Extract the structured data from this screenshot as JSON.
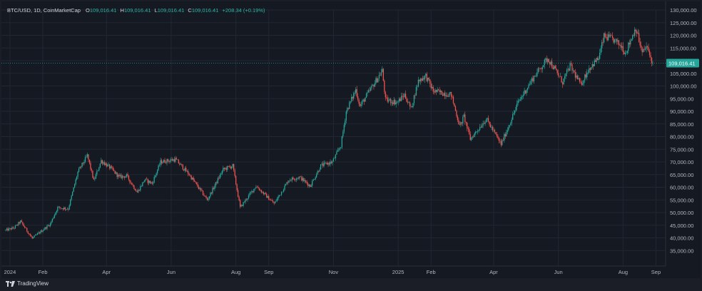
{
  "legend": {
    "symbol": "BTC/USD, 1D, CoinMarketCap",
    "open_label": "O",
    "open": "109,016.41",
    "high_label": "H",
    "high": "109,016.41",
    "low_label": "L",
    "low": "109,016.41",
    "close_label": "C",
    "close": "109,016.41",
    "change": "+208.34 (+0.19%)"
  },
  "price_badge": "109,016.41",
  "footer": {
    "brand": "TradingView",
    "logo_icon": "tradingview-logo-icon"
  },
  "colors": {
    "up": "#26a69a",
    "down": "#ef5350",
    "background": "#151922",
    "grid": "#232733",
    "text": "#b2b5be",
    "badge": "#26a69a"
  },
  "chart_data": {
    "type": "candlestick",
    "title": "BTC/USD, 1D, CoinMarketCap",
    "ylim": [
      30000,
      130000
    ],
    "y_ticks": [
      "35,000.00",
      "40,000.00",
      "45,000.00",
      "50,000.00",
      "55,000.00",
      "60,000.00",
      "65,000.00",
      "70,000.00",
      "75,000.00",
      "80,000.00",
      "85,000.00",
      "90,000.00",
      "95,000.00",
      "100,000.00",
      "105,000.00",
      "110,000.00",
      "115,000.00",
      "120,000.00",
      "125,000.00",
      "130,000.00"
    ],
    "x_ticks": [
      {
        "label": "2024",
        "date": "2024-01-01"
      },
      {
        "label": "Feb",
        "date": "2024-02-01"
      },
      {
        "label": "Apr",
        "date": "2024-04-01"
      },
      {
        "label": "Jun",
        "date": "2024-06-01"
      },
      {
        "label": "Aug",
        "date": "2024-08-01"
      },
      {
        "label": "Sep",
        "date": "2024-09-01"
      },
      {
        "label": "Nov",
        "date": "2024-11-01"
      },
      {
        "label": "2025",
        "date": "2025-01-01"
      },
      {
        "label": "Feb",
        "date": "2025-02-01"
      },
      {
        "label": "Apr",
        "date": "2025-04-01"
      },
      {
        "label": "Jun",
        "date": "2025-06-01"
      },
      {
        "label": "Aug",
        "date": "2025-08-01"
      },
      {
        "label": "Sep",
        "date": "2025-09-01"
      }
    ],
    "start_date": "2023-12-28",
    "end_date": "2025-08-29",
    "last_price": 109016.41,
    "close_path": [
      [
        "2023-12-28",
        43000
      ],
      [
        "2024-01-05",
        44000
      ],
      [
        "2024-01-11",
        46500
      ],
      [
        "2024-01-22",
        39800
      ],
      [
        "2024-02-08",
        45500
      ],
      [
        "2024-02-15",
        52000
      ],
      [
        "2024-02-25",
        51500
      ],
      [
        "2024-03-05",
        66000
      ],
      [
        "2024-03-14",
        72500
      ],
      [
        "2024-03-20",
        62500
      ],
      [
        "2024-03-27",
        70500
      ],
      [
        "2024-04-05",
        67500
      ],
      [
        "2024-04-13",
        64000
      ],
      [
        "2024-04-20",
        64500
      ],
      [
        "2024-04-30",
        58000
      ],
      [
        "2024-05-07",
        63000
      ],
      [
        "2024-05-14",
        61500
      ],
      [
        "2024-05-22",
        70000
      ],
      [
        "2024-06-05",
        71000
      ],
      [
        "2024-06-18",
        65000
      ],
      [
        "2024-07-05",
        55000
      ],
      [
        "2024-07-20",
        67000
      ],
      [
        "2024-07-29",
        68500
      ],
      [
        "2024-08-05",
        52000
      ],
      [
        "2024-08-20",
        60500
      ],
      [
        "2024-09-06",
        53500
      ],
      [
        "2024-09-20",
        63000
      ],
      [
        "2024-09-30",
        64000
      ],
      [
        "2024-10-10",
        60500
      ],
      [
        "2024-10-20",
        68500
      ],
      [
        "2024-10-31",
        70000
      ],
      [
        "2024-11-08",
        76500
      ],
      [
        "2024-11-13",
        90000
      ],
      [
        "2024-11-22",
        98500
      ],
      [
        "2024-11-26",
        92000
      ],
      [
        "2024-12-05",
        98000
      ],
      [
        "2024-12-17",
        106000
      ],
      [
        "2024-12-20",
        94500
      ],
      [
        "2024-12-31",
        93500
      ],
      [
        "2025-01-07",
        96500
      ],
      [
        "2025-01-13",
        91000
      ],
      [
        "2025-01-20",
        102000
      ],
      [
        "2025-01-27",
        104000
      ],
      [
        "2025-02-03",
        98000
      ],
      [
        "2025-02-20",
        96500
      ],
      [
        "2025-02-28",
        84000
      ],
      [
        "2025-03-04",
        88000
      ],
      [
        "2025-03-10",
        79000
      ],
      [
        "2025-03-25",
        87000
      ],
      [
        "2025-04-08",
        77000
      ],
      [
        "2025-04-15",
        84000
      ],
      [
        "2025-04-24",
        93500
      ],
      [
        "2025-05-08",
        103000
      ],
      [
        "2025-05-22",
        111000
      ],
      [
        "2025-06-05",
        101500
      ],
      [
        "2025-06-12",
        108000
      ],
      [
        "2025-06-22",
        100500
      ],
      [
        "2025-06-30",
        107000
      ],
      [
        "2025-07-09",
        111000
      ],
      [
        "2025-07-14",
        119500
      ],
      [
        "2025-07-22",
        118500
      ],
      [
        "2025-07-31",
        115500
      ],
      [
        "2025-08-03",
        113000
      ],
      [
        "2025-08-13",
        123000
      ],
      [
        "2025-08-19",
        113000
      ],
      [
        "2025-08-23",
        115500
      ],
      [
        "2025-08-29",
        109016
      ]
    ]
  }
}
